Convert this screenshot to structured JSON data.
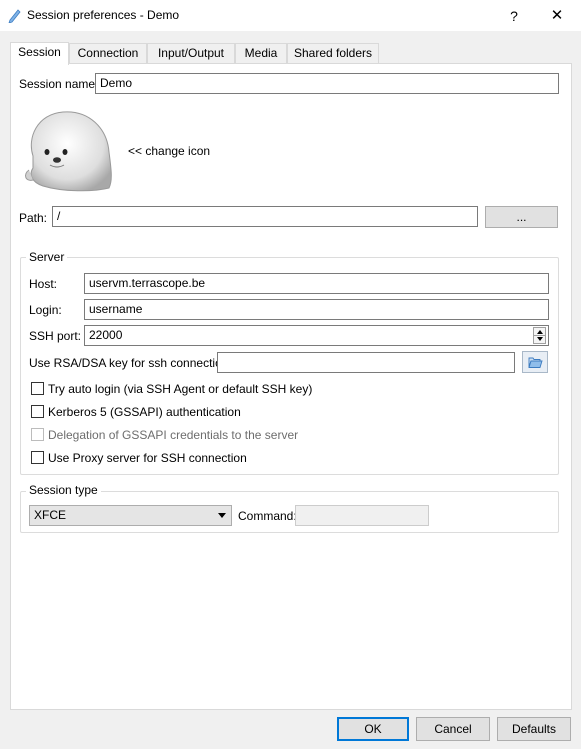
{
  "window": {
    "title": "Session preferences - Demo",
    "help_label": "?",
    "close_label": "✕"
  },
  "tabs": [
    {
      "label": "Session",
      "active": true
    },
    {
      "label": "Connection"
    },
    {
      "label": "Input/Output"
    },
    {
      "label": "Media"
    },
    {
      "label": "Shared folders"
    }
  ],
  "session": {
    "name_label": "Session name:",
    "name_value": "Demo",
    "change_icon_label": "<< change icon",
    "path_label": "Path:",
    "path_value": "/",
    "browse_label": "..."
  },
  "server": {
    "group_title": "Server",
    "host_label": "Host:",
    "host_value": "uservm.terrascope.be",
    "login_label": "Login:",
    "login_value": "username",
    "port_label": "SSH port:",
    "port_value": "22000",
    "key_label": "Use RSA/DSA key for ssh connection:",
    "key_value": "",
    "checkboxes": [
      {
        "label": "Try auto login (via SSH Agent or default SSH key)",
        "checked": false,
        "enabled": true
      },
      {
        "label": "Kerberos 5 (GSSAPI) authentication",
        "checked": false,
        "enabled": true
      },
      {
        "label": "Delegation of GSSAPI credentials to the server",
        "checked": false,
        "enabled": false
      },
      {
        "label": "Use Proxy server for SSH connection",
        "checked": false,
        "enabled": true
      }
    ]
  },
  "session_type": {
    "group_title": "Session type",
    "selected": "XFCE",
    "command_label": "Command:",
    "command_value": ""
  },
  "footer": {
    "ok_label": "OK",
    "cancel_label": "Cancel",
    "defaults_label": "Defaults"
  },
  "colors": {
    "accent": "#0078d7",
    "title_icon": "#4a8fd8"
  }
}
